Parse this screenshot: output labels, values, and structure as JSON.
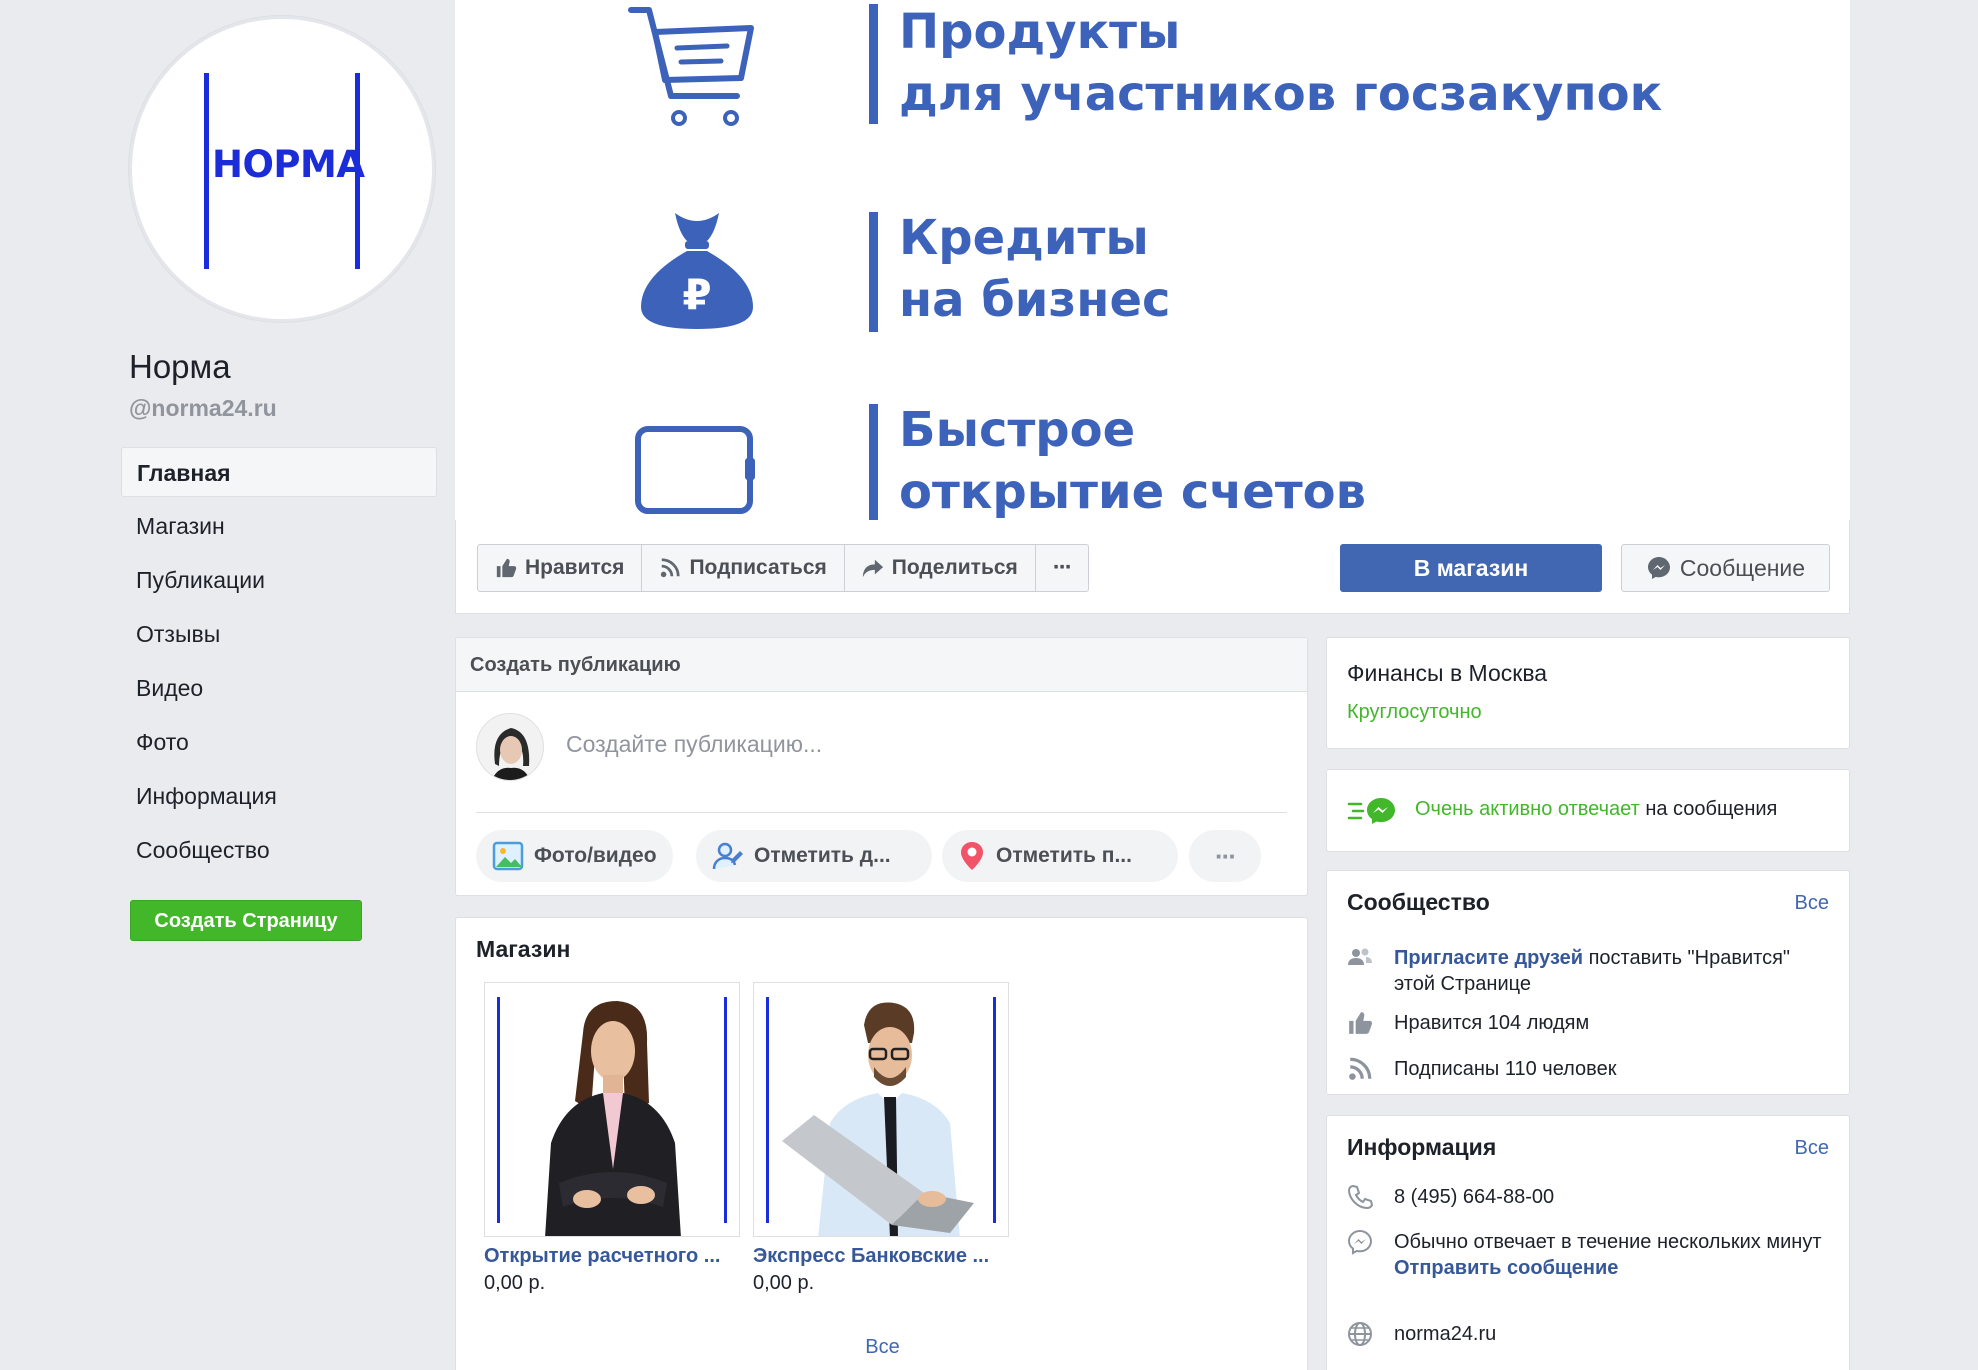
{
  "page": {
    "name": "Норма",
    "handle": "@norma24.ru",
    "logo_text": "НОРМА"
  },
  "nav": {
    "items": [
      {
        "label": "Главная",
        "active": true
      },
      {
        "label": "Магазин"
      },
      {
        "label": "Публикации"
      },
      {
        "label": "Отзывы"
      },
      {
        "label": "Видео"
      },
      {
        "label": "Фото"
      },
      {
        "label": "Информация"
      },
      {
        "label": "Сообщество"
      }
    ],
    "create_page_label": "Создать Страницу"
  },
  "cover": {
    "rows": [
      {
        "line1": "Продукты",
        "line2": "для участников госзакупок",
        "icon": "shopping-cart-icon"
      },
      {
        "line1": "Кредиты",
        "line2": "на бизнес",
        "icon": "money-bag-ruble-icon"
      },
      {
        "line1": "Быстрое",
        "line2": "открытие счетов",
        "icon": "card-icon"
      }
    ],
    "color": "#3c62ba"
  },
  "actions": {
    "like": "Нравится",
    "follow": "Подписаться",
    "share": "Поделиться",
    "more": "···",
    "shop": "В магазин",
    "message": "Сообщение"
  },
  "composer": {
    "title": "Создать публикацию",
    "placeholder": "Создайте публикацию...",
    "photo_video": "Фото/видео",
    "tag_friends": "Отметить д...",
    "check_in": "Отметить п...",
    "more": "···"
  },
  "shop": {
    "title": "Магазин",
    "products": [
      {
        "name": "Открытие расчетного ...",
        "price": "0,00 р."
      },
      {
        "name": "Экспресс Банковские ...",
        "price": "0,00 р."
      }
    ],
    "all_label": "Все"
  },
  "about": {
    "category": "Финансы в Москва",
    "hours": "Круглосуточно"
  },
  "responsiveness": {
    "highlight": "Очень активно отвечает",
    "rest": " на сообщения"
  },
  "community": {
    "title": "Сообщество",
    "all_label": "Все",
    "invite_link": "Пригласите друзей",
    "invite_rest": " поставить \"Нравится\" этой Странице",
    "likes": "Нравится 104 людям",
    "followers": "Подписаны 110 человек"
  },
  "info": {
    "title": "Информация",
    "all_label": "Все",
    "phone": "8 (495) 664-88-00",
    "response_time": "Обычно отвечает в течение нескольких минут",
    "send_message": "Отправить сообщение",
    "website": "norma24.ru"
  },
  "colors": {
    "fb_blue": "#4267b2",
    "link": "#365899",
    "green": "#42b72a",
    "brand": "#1a2dd8"
  }
}
